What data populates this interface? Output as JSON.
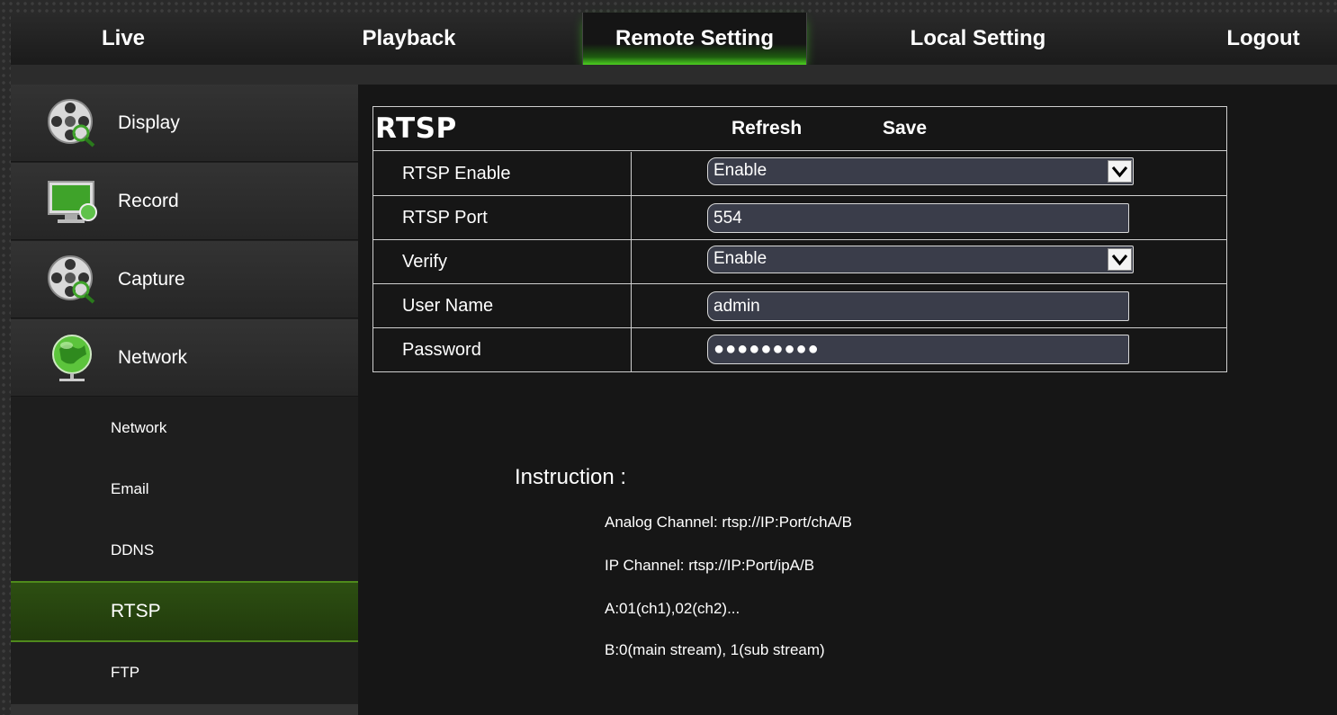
{
  "topnav": {
    "tabs": [
      {
        "label": "Live"
      },
      {
        "label": "Playback"
      },
      {
        "label": "Remote Setting"
      },
      {
        "label": "Local Setting"
      },
      {
        "label": "Logout"
      }
    ],
    "active_tab": "Remote Setting",
    "accent_color": "#4cd020"
  },
  "sidebar": {
    "main_items": [
      {
        "label": "Display",
        "icon": "film-reel-magnifier-icon"
      },
      {
        "label": "Record",
        "icon": "monitor-icon"
      },
      {
        "label": "Capture",
        "icon": "film-reel-magnifier-icon"
      },
      {
        "label": "Network",
        "icon": "globe-icon"
      }
    ],
    "sub_items": [
      {
        "label": "Network"
      },
      {
        "label": "Email"
      },
      {
        "label": "DDNS"
      },
      {
        "label": "RTSP"
      },
      {
        "label": "FTP"
      }
    ],
    "active_sub": "RTSP"
  },
  "panel": {
    "title": "RTSP",
    "refresh_label": "Refresh",
    "save_label": "Save",
    "rows": [
      {
        "label": "RTSP Enable",
        "type": "select",
        "value": "Enable"
      },
      {
        "label": "RTSP Port",
        "type": "text",
        "value": "554"
      },
      {
        "label": "Verify",
        "type": "select",
        "value": "Enable"
      },
      {
        "label": "User Name",
        "type": "text",
        "value": "admin"
      },
      {
        "label": "Password",
        "type": "password",
        "value": "●●●●●●●●●"
      }
    ]
  },
  "instruction": {
    "title": "Instruction :",
    "lines": [
      "Analog Channel: rtsp://IP:Port/chA/B",
      "IP Channel: rtsp://IP:Port/ipA/B",
      "A:01(ch1),02(ch2)...",
      "B:0(main stream), 1(sub stream)"
    ]
  }
}
